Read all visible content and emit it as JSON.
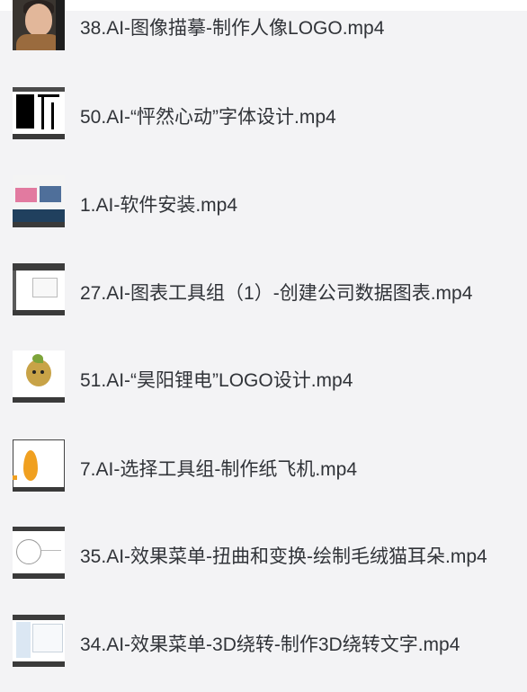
{
  "video_list": {
    "items": [
      {
        "name": "38.AI-图像描摹-制作人像LOGO.mp4",
        "thumbnail": "portrait-photo-thumbnail"
      },
      {
        "name": "50.AI-“怦然心动”字体设计.mp4",
        "thumbnail": "black-typography-thumbnail"
      },
      {
        "name": "1.AI-软件安装.mp4",
        "thumbnail": "website-thumbnail"
      },
      {
        "name": "27.AI-图表工具组（1）-创建公司数据图表.mp4",
        "thumbnail": "illustrator-workspace-thumbnail"
      },
      {
        "name": "51.AI-“昊阳锂电”LOGO设计.mp4",
        "thumbnail": "character-logo-thumbnail"
      },
      {
        "name": "7.AI-选择工具组-制作纸飞机.mp4",
        "thumbnail": "paper-plane-thumbnail"
      },
      {
        "name": "35.AI-效果菜单-扭曲和变换-绘制毛绒猫耳朵.mp4",
        "thumbnail": "circle-drawing-thumbnail"
      },
      {
        "name": "34.AI-效果菜单-3D绕转-制作3D绕转文字.mp4",
        "thumbnail": "file-window-thumbnail"
      }
    ]
  }
}
